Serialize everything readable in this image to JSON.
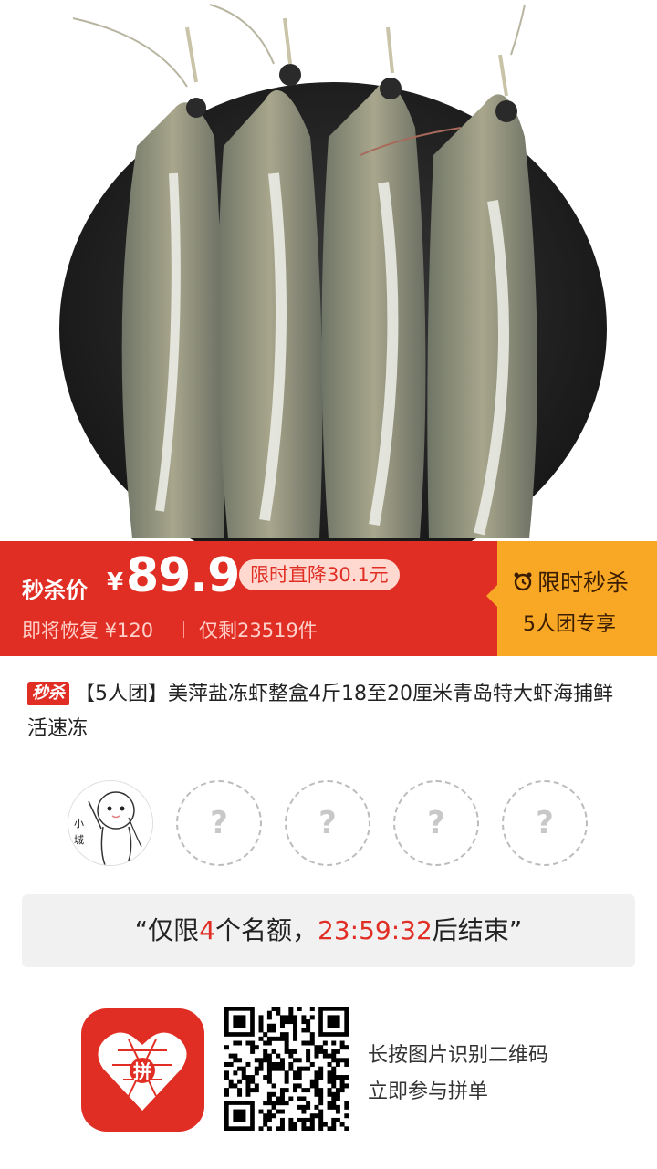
{
  "banner": {
    "flash_label": "秒杀价",
    "currency": "¥",
    "price": "89.9",
    "drop_badge": "限时直降30.1元",
    "restore_text": "即将恢复 ¥120",
    "remaining_text": "仅剩23519件",
    "flash_title": "限时秒杀",
    "group_text": "5人团专享"
  },
  "product": {
    "tag": "秒杀",
    "title": "【5人团】美萍盐冻虾整盒4斤18至20厘米青岛特大虾海捕鲜活速冻"
  },
  "group": {
    "placeholder": "?",
    "avatar_caption": "小城"
  },
  "quote": {
    "open": "“仅限",
    "count": "4",
    "middle": "个名额，",
    "timer": "23:59:32",
    "close": "后结束”"
  },
  "footer": {
    "logo_char": "拼",
    "tip_line1": "长按图片识别二维码",
    "tip_line2": "立即参与拼单"
  },
  "colors": {
    "brand_red": "#e02e24",
    "flash_orange": "#f9a825"
  }
}
